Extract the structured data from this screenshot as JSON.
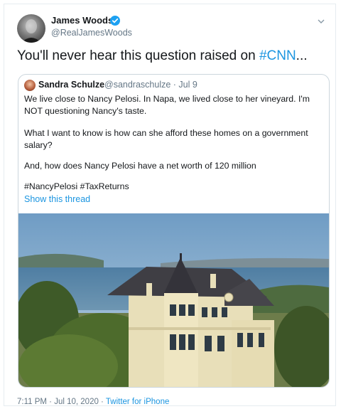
{
  "tweet": {
    "author_name": "James Woods",
    "author_handle": "@RealJamesWoods",
    "text_prefix": "You'll never hear this question raised on ",
    "text_hashtag": "#CNN",
    "text_suffix": "...",
    "timestamp": "7:11 PM · Jul 10, 2020 · ",
    "source": "Twitter for iPhone"
  },
  "quote": {
    "author_name": "Sandra Schulze",
    "author_handle": "@sandraschulze · Jul 9",
    "lines": [
      "We live close to Nancy Pelosi.  In Napa, we lived close to her vineyard. I'm",
      "NOT questioning Nancy's taste.",
      "What I want to know is how can she afford these homes on a government",
      "salary?",
      "And, how does Nancy Pelosi have a net worth of 120 million",
      "#NancyPelosi #TaxReturns"
    ],
    "show_thread": "Show this thread"
  },
  "icons": [
    "verified-badge-icon",
    "chevron-down-icon"
  ],
  "colors": {
    "link": "#1b95e0",
    "muted": "#657786",
    "verified": "#1da1f2"
  }
}
